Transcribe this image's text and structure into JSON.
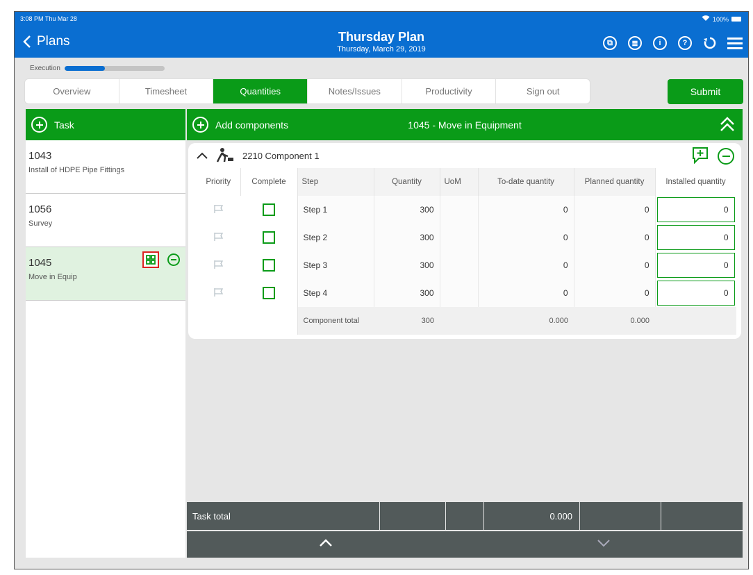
{
  "status": {
    "time": "3:08 PM Thu Mar 28",
    "battery": "100%"
  },
  "header": {
    "back_label": "Plans",
    "title": "Thursday Plan",
    "subtitle": "Thursday, March 29, 2019"
  },
  "execution": {
    "label": "Execution",
    "progress_fraction": 0.4
  },
  "tabs": [
    {
      "label": "Overview",
      "active": false
    },
    {
      "label": "Timesheet",
      "active": false
    },
    {
      "label": "Quantities",
      "active": true
    },
    {
      "label": "Notes/Issues",
      "active": false
    },
    {
      "label": "Productivity",
      "active": false
    },
    {
      "label": "Sign out",
      "active": false
    }
  ],
  "submit_label": "Submit",
  "task_panel": {
    "header_label": "Task",
    "tasks": [
      {
        "number": "1043",
        "description": "Install of HDPE Pipe Fittings",
        "selected": false
      },
      {
        "number": "1056",
        "description": "Survey",
        "selected": false
      },
      {
        "number": "1045",
        "description": "Move in Equip",
        "selected": true
      }
    ]
  },
  "components_panel": {
    "add_label": "Add components",
    "title": "1045 - Move in Equipment",
    "component": {
      "name": "2210 Component 1",
      "columns": [
        "Priority",
        "Complete",
        "Step",
        "Quantity",
        "UoM",
        "To-date quantity",
        "Planned quantity",
        "Installed quantity"
      ],
      "rows": [
        {
          "step": "Step 1",
          "quantity": "300",
          "uom": "",
          "to_date": "0",
          "planned": "0",
          "installed": "0"
        },
        {
          "step": "Step 2",
          "quantity": "300",
          "uom": "",
          "to_date": "0",
          "planned": "0",
          "installed": "0"
        },
        {
          "step": "Step 3",
          "quantity": "300",
          "uom": "",
          "to_date": "0",
          "planned": "0",
          "installed": "0"
        },
        {
          "step": "Step 4",
          "quantity": "300",
          "uom": "",
          "to_date": "0",
          "planned": "0",
          "installed": "0"
        }
      ],
      "total": {
        "label": "Component total",
        "quantity": "300",
        "to_date": "0.000",
        "planned": "0.000"
      }
    }
  },
  "task_total": {
    "label": "Task total",
    "to_date": "0.000"
  },
  "colors": {
    "header_blue": "#0a6ed1",
    "accent_green": "#0a9b18",
    "footer_gray": "#525a5a"
  }
}
